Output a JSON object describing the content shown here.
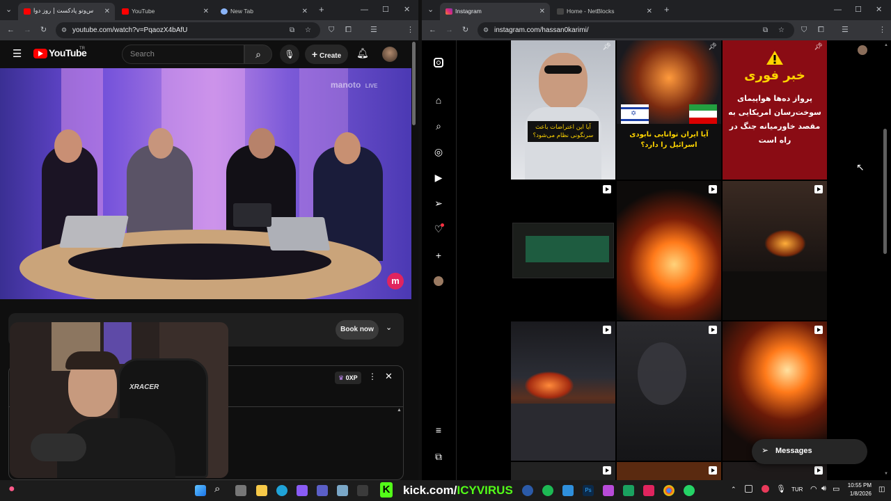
{
  "left_window": {
    "tabs": [
      {
        "label": "س‌وتو پادکست | روز دوا"
      },
      {
        "label": "YouTube"
      },
      {
        "label": "New Tab"
      }
    ],
    "url": "youtube.com/watch?v=PqaozX4bAfU",
    "youtube": {
      "logo_text": "YouTube",
      "logo_region": "TR",
      "search_placeholder": "Search",
      "create_label": "Create"
    },
    "video": {
      "watermark": "manoto",
      "watermark_live": "LIVE"
    },
    "book_now_label": "Book now",
    "xp_badge": "0XP"
  },
  "right_window": {
    "tabs": [
      {
        "label": "Instagram"
      },
      {
        "label": "Home - NetBlocks"
      }
    ],
    "url": "instagram.com/hassan0karimi/",
    "posts": [
      {
        "caption": "آیا این اعتراضات باعث سرنگونی نظام می‌شود؟"
      },
      {
        "caption": "آیا ایران توانایی نابودی اسرائیل را دارد؟"
      },
      {
        "headline": "خبر فوری",
        "body": "پرواز ده‌ها هواپیمای سوخت‌رسان امریکایی به مقصد خاورمیانه جنگ در راه است"
      }
    ],
    "messages_label": "Messages"
  },
  "taskbar": {
    "kick_prefix": "kick.com/",
    "kick_user": "ICYVIRUS",
    "lang": "TUR",
    "time": "10:55 PM",
    "date": "1/8/2026"
  }
}
